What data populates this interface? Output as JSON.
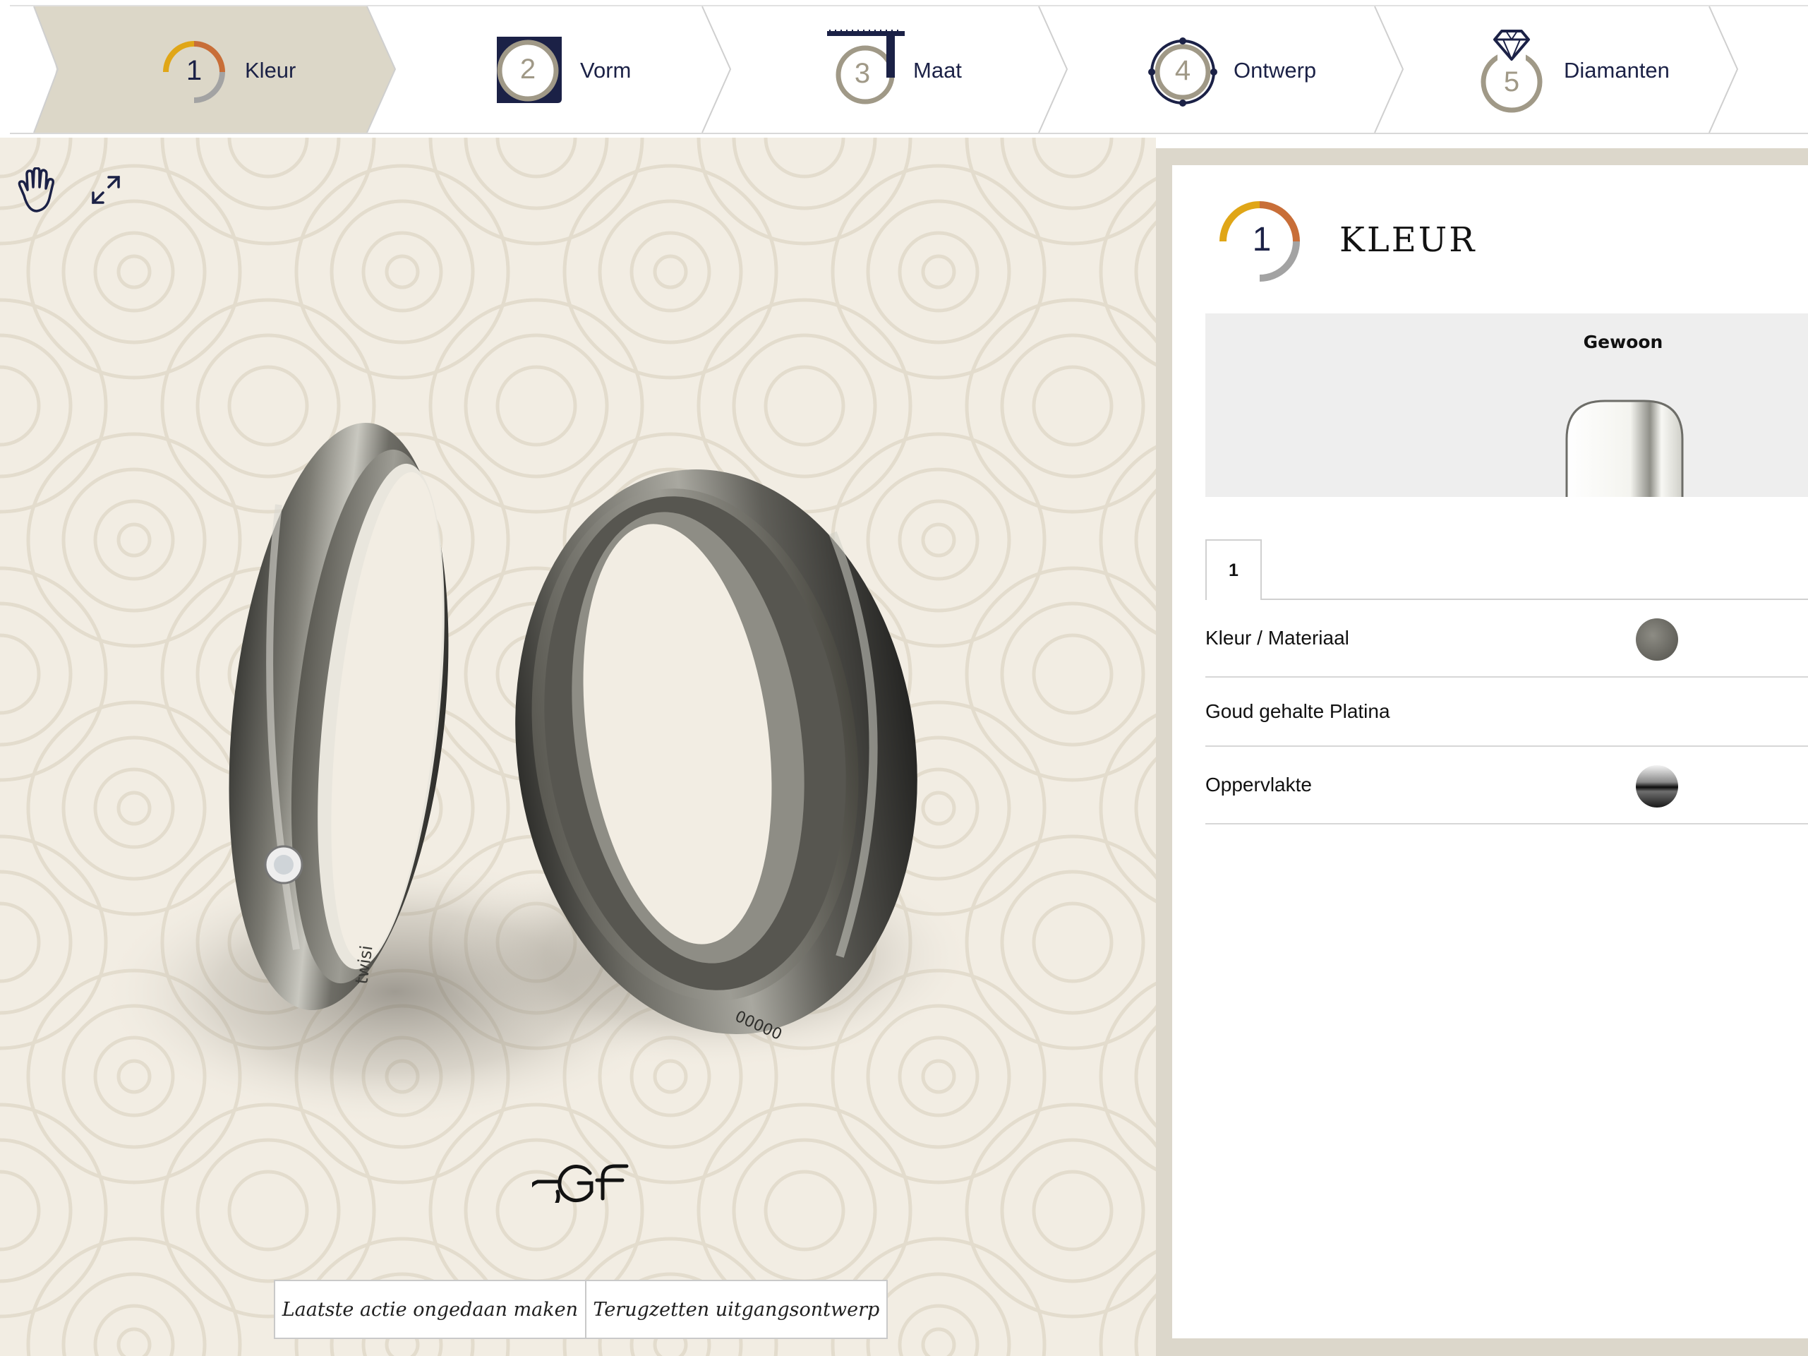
{
  "steps": [
    {
      "number": "1",
      "label": "Kleur",
      "active": true
    },
    {
      "number": "2",
      "label": "Vorm",
      "active": false
    },
    {
      "number": "3",
      "label": "Maat",
      "active": false
    },
    {
      "number": "4",
      "label": "Ontwerp",
      "active": false
    },
    {
      "number": "5",
      "label": "Diamanten",
      "active": false
    }
  ],
  "viewer": {
    "tools": {
      "pan_icon": "hand-icon",
      "fullscreen_icon": "expand-icon"
    },
    "ring_engravings": {
      "ring_left": "twisi",
      "ring_right": "00000"
    },
    "actions": {
      "undo_label": "Laatste actie ongedaan maken",
      "reset_label": "Terugzetten uitgangsontwerp"
    }
  },
  "panel": {
    "step_number": "1",
    "title": "KLEUR",
    "card": {
      "label": "Gewoon"
    },
    "tabs": [
      "1"
    ],
    "properties": [
      {
        "label": "Kleur / Materiaal",
        "swatch": "grey-metal"
      },
      {
        "label": "Goud gehalte Platina",
        "swatch": null
      },
      {
        "label": "Oppervlakte",
        "swatch": "polished"
      }
    ]
  },
  "colors": {
    "navy": "#1b2146",
    "active_step_bg": "#dcd7c8",
    "viewer_bg": "#f2ede3",
    "accent_yellow": "#e0a617",
    "accent_orange": "#c86e38",
    "accent_grey": "#9a9a9a",
    "taupe": "#a09987"
  }
}
